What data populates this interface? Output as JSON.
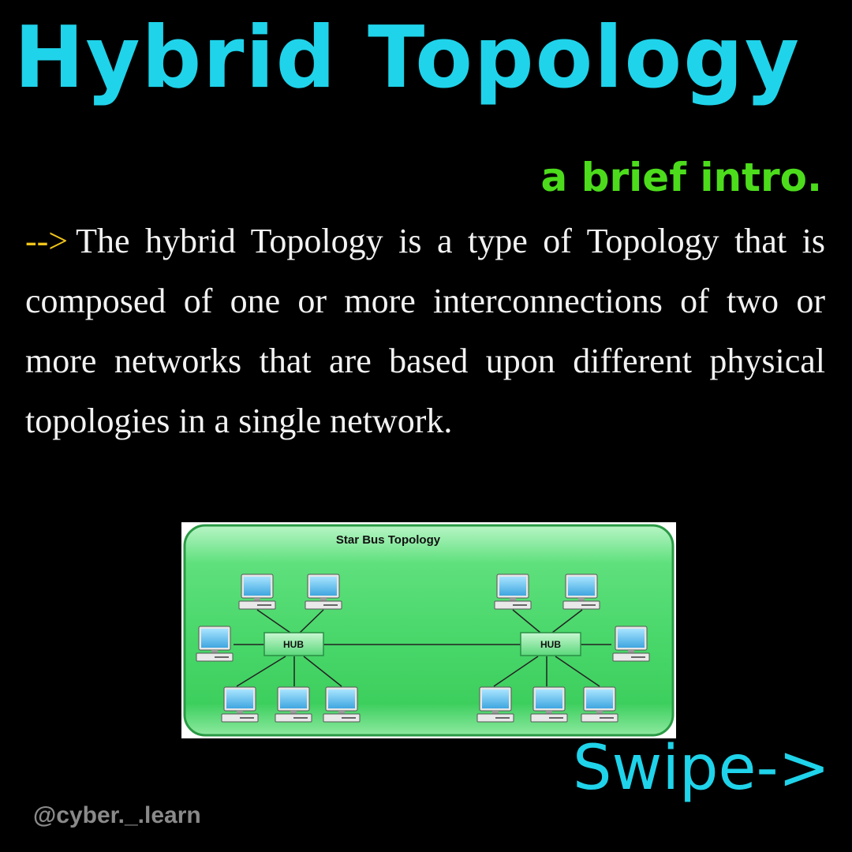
{
  "title": "Hybrid Topology",
  "subtitle": "a brief intro.",
  "body": {
    "arrow": "-->",
    "text": "The hybrid Topology is a type of Topology that is composed of one or more interconnections of two or more networks that are based upon different physical topologies in a single network."
  },
  "diagram": {
    "title": "Star Bus Topology",
    "left_hub_label": "HUB",
    "right_hub_label": "HUB"
  },
  "swipe": "Swipe->",
  "handle": "@cyber._.learn",
  "colors": {
    "title": "#1fd3ea",
    "subtitle": "#4cdc1c",
    "arrow": "#f0c419",
    "panel": "#3fdc6a"
  }
}
